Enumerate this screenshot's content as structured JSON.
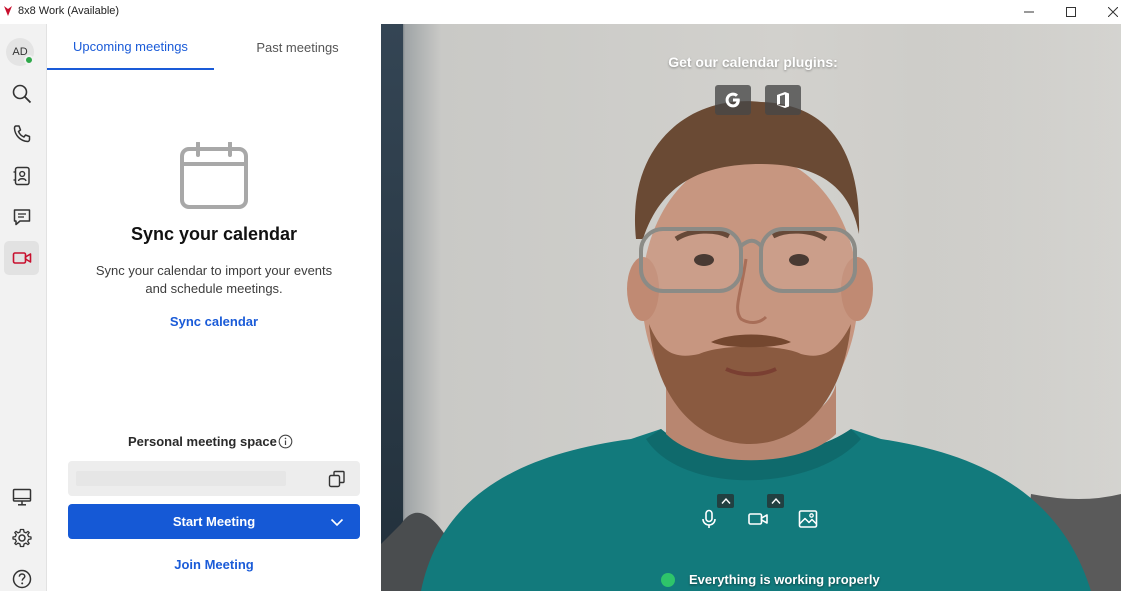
{
  "window": {
    "title": "8x8 Work (Available)",
    "brand_color": "#c8102e"
  },
  "rail": {
    "avatar_initials": "AD",
    "presence": "available",
    "items": [
      {
        "name": "search",
        "icon": "search-icon"
      },
      {
        "name": "calls",
        "icon": "phone-icon"
      },
      {
        "name": "contacts",
        "icon": "contacts-icon"
      },
      {
        "name": "messages",
        "icon": "chat-icon"
      },
      {
        "name": "meetings",
        "icon": "video-camera-icon",
        "active": true
      },
      {
        "name": "screen",
        "icon": "monitor-icon"
      },
      {
        "name": "settings",
        "icon": "gear-icon"
      },
      {
        "name": "help",
        "icon": "help-icon"
      }
    ]
  },
  "meetings": {
    "tabs": [
      {
        "label": "Upcoming meetings",
        "active": true
      },
      {
        "label": "Past meetings",
        "active": false
      }
    ],
    "empty_state": {
      "title": "Sync your calendar",
      "description": "Sync your calendar to import your events and schedule meetings.",
      "link": "Sync calendar"
    },
    "personal_space": {
      "label": "Personal meeting space",
      "link_value": ""
    },
    "start_button": "Start Meeting",
    "join_link": "Join Meeting",
    "accent_color": "#1559d6"
  },
  "preview": {
    "plugins_label": "Get our calendar plugins:",
    "plugins": [
      "google-icon",
      "office-icon"
    ],
    "controls": [
      "microphone-icon",
      "camera-icon",
      "background-image-icon"
    ],
    "status_text": "Everything is working properly",
    "status_color": "#2ec46a"
  }
}
